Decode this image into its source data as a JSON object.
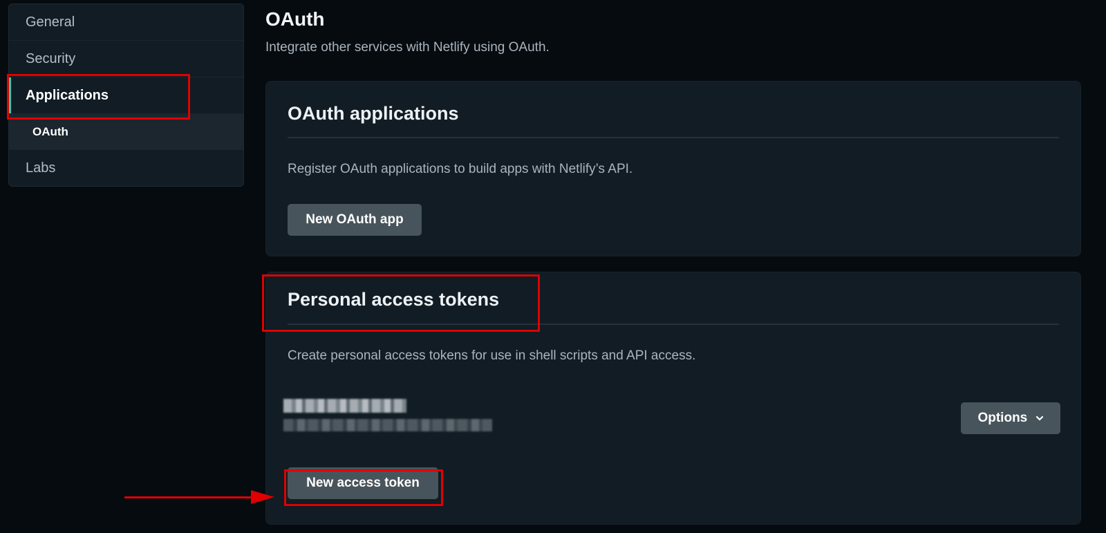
{
  "sidebar": {
    "items": [
      {
        "label": "General"
      },
      {
        "label": "Security"
      },
      {
        "label": "Applications"
      },
      {
        "label": "OAuth"
      },
      {
        "label": "Labs"
      }
    ]
  },
  "header": {
    "title": "OAuth",
    "subtitle": "Integrate other services with Netlify using OAuth."
  },
  "oauth_apps": {
    "title": "OAuth applications",
    "description": "Register OAuth applications to build apps with Netlify’s API.",
    "button_label": "New OAuth app"
  },
  "tokens": {
    "title": "Personal access tokens",
    "description": "Create personal access tokens for use in shell scripts and API access.",
    "options_label": "Options",
    "options_icon": "chevron-down-icon",
    "button_label": "New access token"
  },
  "colors": {
    "background": "#060b10",
    "card": "#111c24",
    "accent": "#32c8b0",
    "button": "#48545c",
    "annotation": "#e00000"
  }
}
